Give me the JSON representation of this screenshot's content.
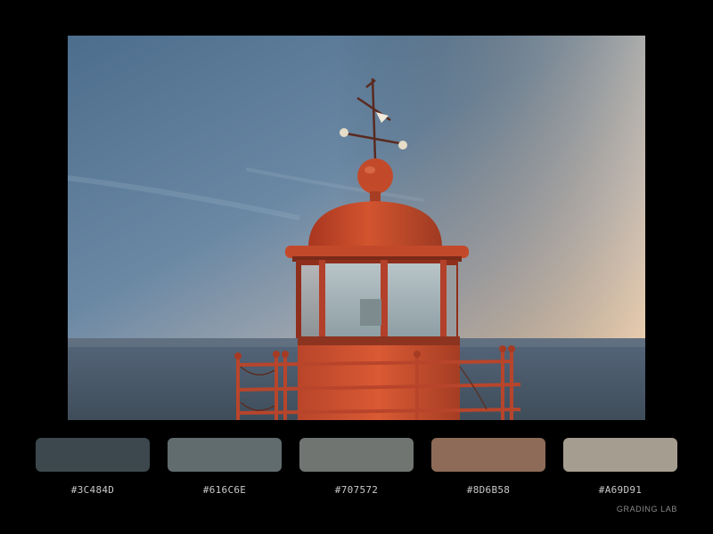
{
  "photo": {
    "alt": "Red lighthouse lantern with weather vane at dusk over the sea"
  },
  "palette": [
    {
      "hex": "#3C484D",
      "label": "#3C484D"
    },
    {
      "hex": "#616C6E",
      "label": "#616C6E"
    },
    {
      "hex": "#707572",
      "label": "#707572"
    },
    {
      "hex": "#8D6B58",
      "label": "#8D6B58"
    },
    {
      "hex": "#A69D91",
      "label": "#A69D91"
    }
  ],
  "brand": {
    "name": "GRADING LAB"
  },
  "colors": {
    "background": "#000000",
    "lighthouse_red": "#c8462a",
    "sky_top": "#4f6f8d",
    "sky_horizon": "#d8c2ab",
    "sea": "#4a5a66"
  }
}
